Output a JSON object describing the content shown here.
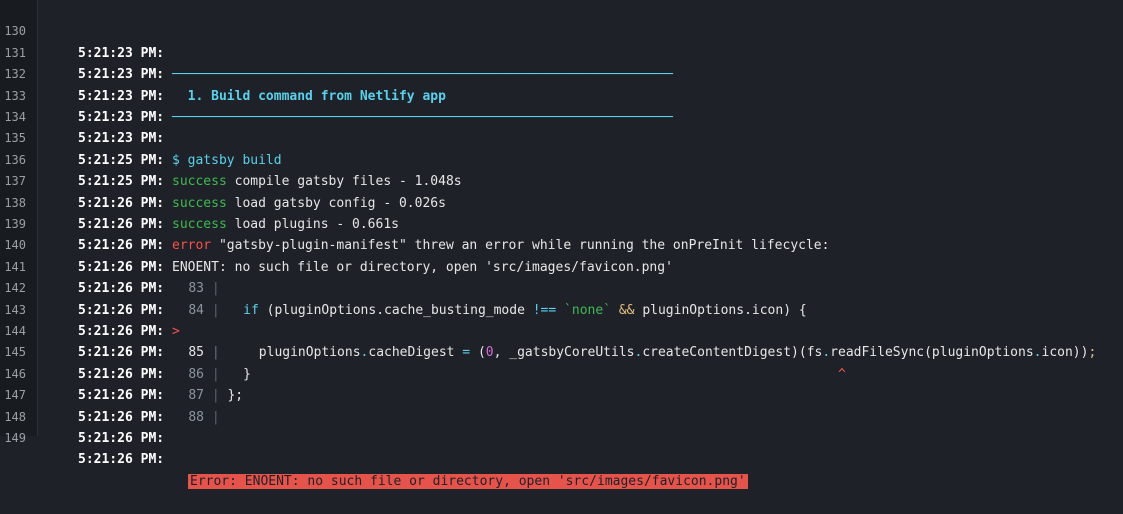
{
  "lines": [
    {
      "n": "130",
      "ts": "5:21:23 PM:",
      "msg": "────────────────────────────────────────────────────────────────"
    },
    {
      "n": "131",
      "ts": "5:21:23 PM:",
      "msg": "  1. Build command from Netlify app"
    },
    {
      "n": "132",
      "ts": "5:21:23 PM:",
      "msg": "────────────────────────────────────────────────────────────────"
    },
    {
      "n": "133",
      "ts": "5:21:23 PM:",
      "msg": ""
    },
    {
      "n": "134",
      "ts": "5:21:23 PM:",
      "msg": "$ gatsby build"
    },
    {
      "n": "135",
      "ts": "5:21:25 PM:",
      "status": "success",
      "msg": " compile gatsby files - 1.048s"
    },
    {
      "n": "136",
      "ts": "5:21:25 PM:",
      "status": "success",
      "msg": " load gatsby config - 0.026s"
    },
    {
      "n": "137",
      "ts": "5:21:26 PM:",
      "status": "success",
      "msg": " load plugins - 0.661s"
    },
    {
      "n": "138",
      "ts": "5:21:26 PM:",
      "status": "error",
      "msg": " \"gatsby-plugin-manifest\" threw an error while running the onPreInit lifecycle:"
    },
    {
      "n": "139",
      "ts": "5:21:26 PM:",
      "msg": "ENOENT: no such file or directory, open 'src/images/favicon.png'"
    },
    {
      "n": "140",
      "ts": "5:21:26 PM:",
      "code_ln": "83",
      "code": ""
    },
    {
      "n": "141",
      "ts": "5:21:26 PM:",
      "code_ln": "84",
      "code_a": "  ",
      "code_kw": "if",
      "code_b": " (pluginOptions.cache_busting_mode ",
      "code_op": "!==",
      "code_c": " ",
      "code_str": "`none`",
      "code_d": " ",
      "code_and": "&&",
      "code_e": " pluginOptions.icon) {"
    },
    {
      "n": "142",
      "ts": "5:21:26 PM:",
      "marker": ">",
      "code_ln": "85",
      "code_a": "    pluginOptions",
      "code_dot1": ".",
      "code_b": "cacheDigest ",
      "code_eq": "=",
      "code_c": " (",
      "code_num": "0",
      "code_d": ", _gatsbyCoreUtils",
      "code_dot2": ".",
      "code_e": "createContentDigest)(fs",
      "code_dot3": ".",
      "code_f": "readFileSync(pluginOptions",
      "code_dot4": ".",
      "code_g": "icon))",
      "code_semi": ";"
    },
    {
      "n": "143",
      "ts": "5:21:26 PM:",
      "code_ln": "",
      "caret": "^"
    },
    {
      "n": "144",
      "ts": "5:21:26 PM:",
      "code_ln": "86",
      "code": "  }"
    },
    {
      "n": "145",
      "ts": "5:21:26 PM:",
      "code_ln": "87",
      "code": "};"
    },
    {
      "n": "146",
      "ts": "5:21:26 PM:",
      "code_ln": "88",
      "code": ""
    },
    {
      "n": "147",
      "ts": "5:21:26 PM:",
      "msg": ""
    },
    {
      "n": "148",
      "ts": "5:21:26 PM:",
      "msg": ""
    },
    {
      "n": "149",
      "ts": "5:21:26 PM:",
      "error_box": "Error: ENOENT: no such file or directory, open 'src/images/favicon.png'"
    }
  ],
  "colors": {
    "background": "#1e2228",
    "cyan": "#58d1eb",
    "success": "#3fb950",
    "error": "#f85149",
    "error_box": "#e5534b"
  }
}
